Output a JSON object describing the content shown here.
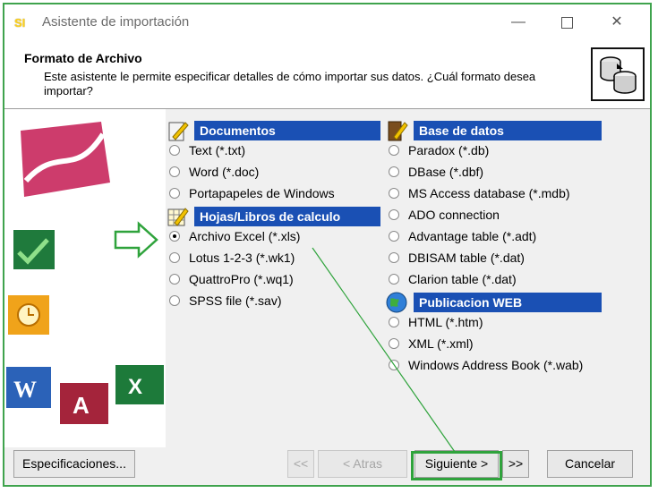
{
  "window": {
    "title": "Asistente de importación",
    "app_icon_text": "SI"
  },
  "header": {
    "title": "Formato de Archivo",
    "description": "Este asistente le permite especificar detalles de cómo importar sus datos. ¿Cuál formato desea importar?"
  },
  "sections": {
    "documentos": {
      "title": "Documentos",
      "options": [
        "Text (*.txt)",
        "Word (*.doc)",
        "Portapapeles de Windows"
      ]
    },
    "hojas": {
      "title": "Hojas/Libros de calculo",
      "options": [
        "Archivo Excel (*.xls)",
        "Lotus 1-2-3 (*.wk1)",
        "QuattroPro (*.wq1)",
        "SPSS file (*.sav)"
      ]
    },
    "base_datos": {
      "title": "Base de datos",
      "options": [
        "Paradox (*.db)",
        "DBase (*.dbf)",
        "MS Access database (*.mdb)",
        "ADO connection",
        "Advantage table (*.adt)",
        "DBISAM table (*.dat)",
        "Clarion table (*.dat)"
      ]
    },
    "web": {
      "title": "Publicacion WEB",
      "options": [
        "HTML (*.htm)",
        "XML (*.xml)",
        "Windows Address Book (*.wab)"
      ]
    }
  },
  "selected_option": "Archivo Excel (*.xls)",
  "buttons": {
    "especificaciones": "Especificaciones...",
    "first": "<<",
    "atras": "< Atras",
    "siguiente": "Siguiente >",
    "last": ">>",
    "cancelar": "Cancelar"
  },
  "colors": {
    "section_bar": "#1a50b4",
    "highlight": "#2fa33c"
  }
}
